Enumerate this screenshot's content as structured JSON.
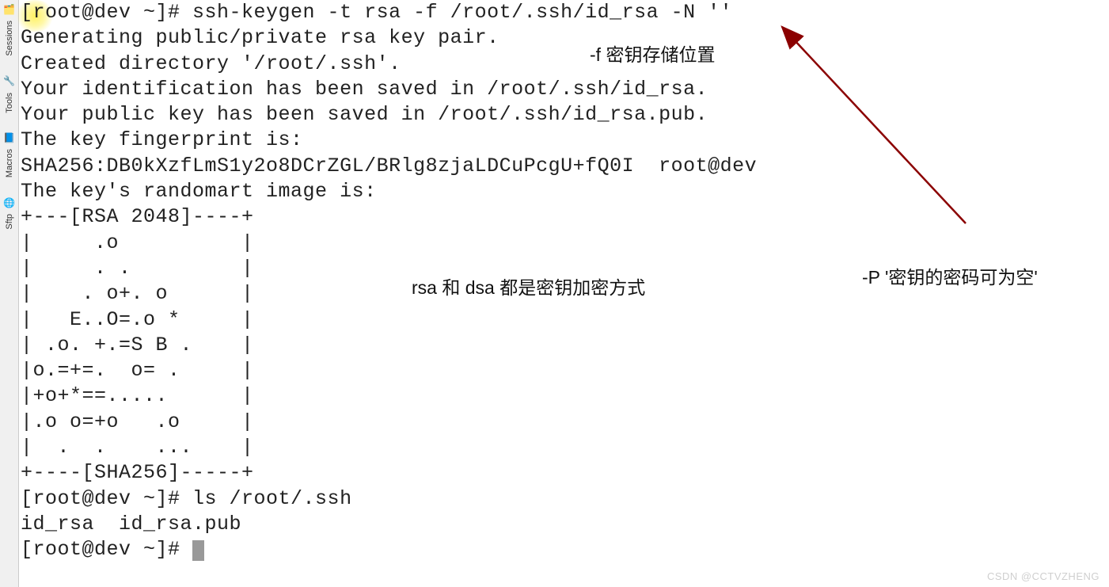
{
  "sidebar": {
    "groups": [
      {
        "label": "Sessions"
      },
      {
        "label": "Tools"
      },
      {
        "label": "Macros"
      },
      {
        "label": "Sftp"
      }
    ]
  },
  "terminal": {
    "lines": [
      "[root@dev ~]# ssh-keygen -t rsa -f /root/.ssh/id_rsa -N ''",
      "Generating public/private rsa key pair.",
      "Created directory '/root/.ssh'.",
      "Your identification has been saved in /root/.ssh/id_rsa.",
      "Your public key has been saved in /root/.ssh/id_rsa.pub.",
      "The key fingerprint is:",
      "SHA256:DB0kXzfLmS1y2o8DCrZGL/BRlg8zjaLDCuPcgU+fQ0I  root@dev",
      "The key's randomart image is:",
      "+---[RSA 2048]----+",
      "|     .o          |",
      "|     . .         |",
      "|    . o+. o      |",
      "|   E..O=.o *     |",
      "| .o. +.=S B .    |",
      "|o.=+=.  o= .     |",
      "|+o+*==.....      |",
      "|.o o=+o   .o     |",
      "|  .  .    ...    |",
      "+----[SHA256]-----+",
      "[root@dev ~]# ls /root/.ssh",
      "id_rsa  id_rsa.pub",
      "[root@dev ~]# "
    ]
  },
  "annotations": {
    "f_option": "-f 密钥存储位置",
    "rsa_dsa": "rsa 和 dsa 都是密钥加密方式",
    "p_option": "-P '密钥的密码可为空'"
  },
  "watermark": "CSDN @CCTVZHENG"
}
